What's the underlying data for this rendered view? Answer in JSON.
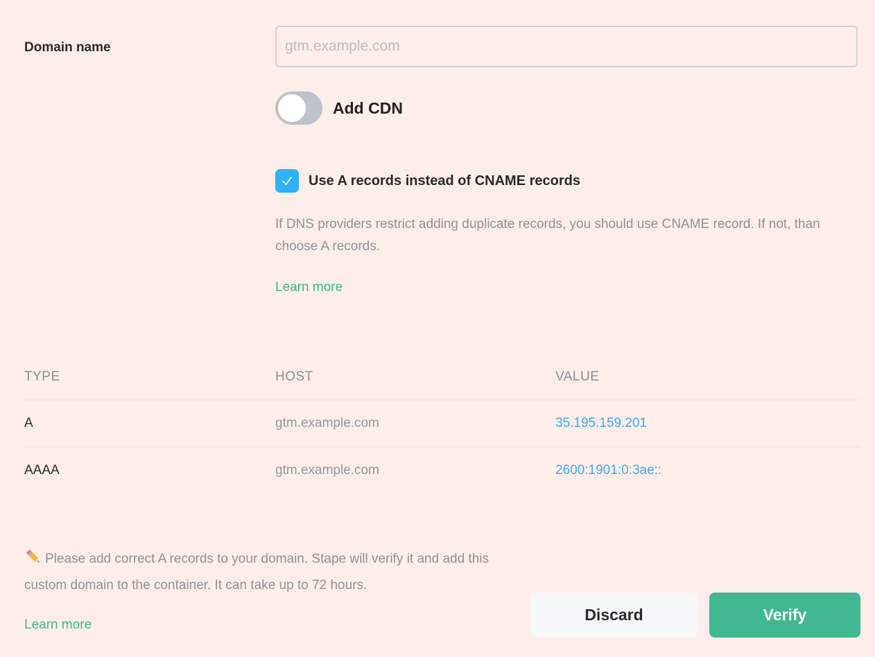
{
  "form": {
    "domain_label": "Domain name",
    "domain_input": {
      "value": "",
      "placeholder": "gtm.example.com"
    },
    "cdn_toggle": {
      "label": "Add CDN",
      "enabled": false
    },
    "a_records_checkbox": {
      "label": "Use A records instead of CNAME records",
      "checked": true
    },
    "help_text": "If DNS providers restrict adding duplicate records, you should use CNAME record. If not, than choose A records.",
    "learn_more": "Learn more"
  },
  "records_table": {
    "headers": [
      "TYPE",
      "HOST",
      "VALUE"
    ],
    "rows": [
      {
        "type": "A",
        "host": "gtm.example.com",
        "value": "35.195.159.201"
      },
      {
        "type": "AAAA",
        "host": "gtm.example.com",
        "value": "2600:1901:0:3ae::"
      }
    ]
  },
  "footer": {
    "note_icon": "pencil-icon",
    "note": "Please add correct A records to your domain. Stape will verify it and add this custom domain to the container. It can take up to 72 hours.",
    "learn_more": "Learn more",
    "discard_label": "Discard",
    "verify_label": "Verify"
  },
  "colors": {
    "background": "#fdeeea",
    "accent_green": "#41b891",
    "link_blue": "#3aaaf0",
    "checkbox_blue": "#2eb1f5"
  }
}
